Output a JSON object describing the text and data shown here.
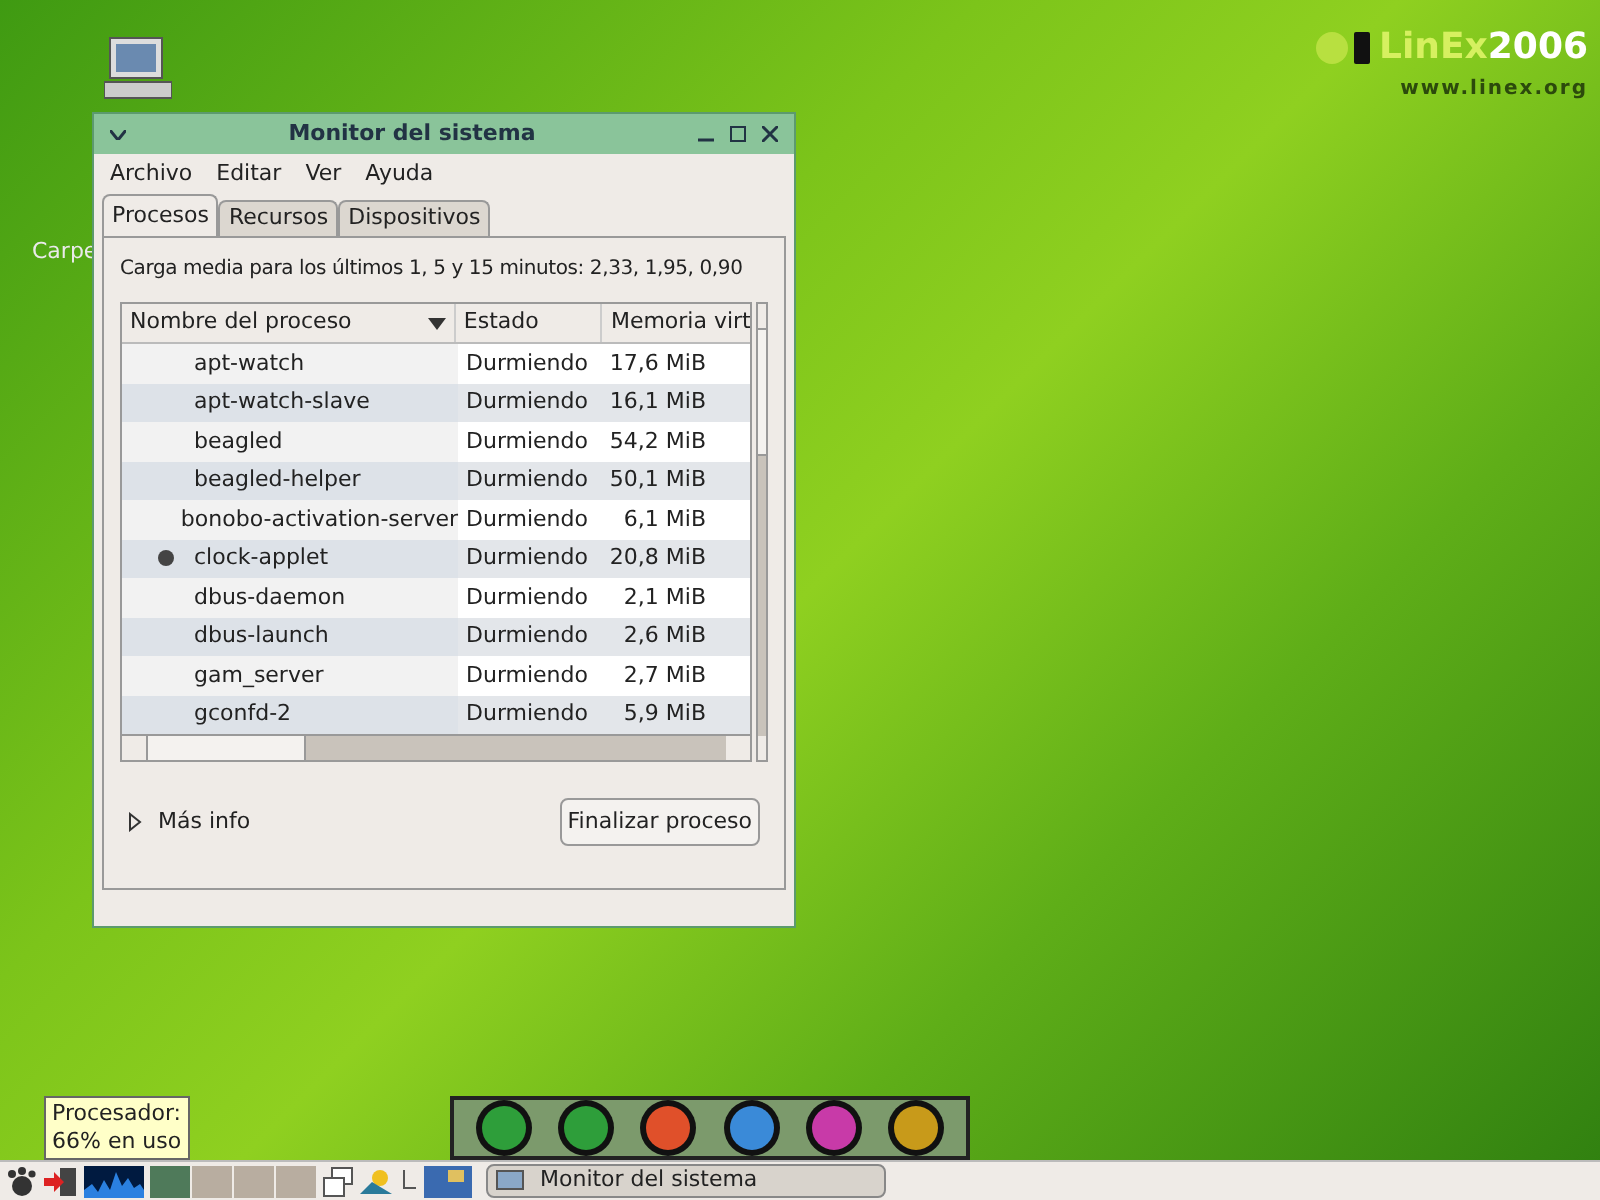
{
  "desktop": {
    "icon_label": "Carpe",
    "logo": {
      "brand": "LinEx",
      "year": "2006",
      "url": "www.linex.org"
    }
  },
  "window": {
    "title": "Monitor del sistema",
    "menu": [
      "Archivo",
      "Editar",
      "Ver",
      "Ayuda"
    ],
    "tabs": [
      {
        "label": "Procesos",
        "selected": true
      },
      {
        "label": "Recursos",
        "selected": false
      },
      {
        "label": "Dispositivos",
        "selected": false
      }
    ],
    "load_text": "Carga media para los últimos 1, 5 y 15 minutos: 2,33, 1,95, 0,90",
    "table": {
      "columns": [
        {
          "label": "Nombre del proceso",
          "sorted": true
        },
        {
          "label": "Estado",
          "sorted": false
        },
        {
          "label": "Memoria virt",
          "sorted": false
        }
      ],
      "rows": [
        {
          "kind": "plain",
          "name": "apt-watch",
          "state": "Durmiendo",
          "memory": "17,6 MiB"
        },
        {
          "kind": "plain",
          "name": "apt-watch-slave",
          "state": "Durmiendo",
          "memory": "16,1 MiB"
        },
        {
          "kind": "plain",
          "name": "beagled",
          "state": "Durmiendo",
          "memory": "54,2 MiB"
        },
        {
          "kind": "plain",
          "name": "beagled-helper",
          "state": "Durmiendo",
          "memory": "50,1 MiB"
        },
        {
          "kind": "plain",
          "name": "bonobo-activation-server",
          "state": "Durmiendo",
          "memory": "6,1 MiB"
        },
        {
          "kind": "applet",
          "name": "clock-applet",
          "state": "Durmiendo",
          "memory": "20,8 MiB"
        },
        {
          "kind": "plain",
          "name": "dbus-daemon",
          "state": "Durmiendo",
          "memory": "2,1 MiB"
        },
        {
          "kind": "plain",
          "name": "dbus-launch",
          "state": "Durmiendo",
          "memory": "2,6 MiB"
        },
        {
          "kind": "plain",
          "name": "gam_server",
          "state": "Durmiendo",
          "memory": "2,7 MiB"
        },
        {
          "kind": "plain",
          "name": "gconfd-2",
          "state": "Durmiendo",
          "memory": "5,9 MiB"
        }
      ]
    },
    "more_info": {
      "label": "Más info",
      "expanded": false
    },
    "end_button": "Finalizar proceso"
  },
  "tooltip": {
    "lines": [
      "Procesador:",
      "66% en uso"
    ]
  },
  "dock": {
    "items": [
      {
        "color": "#2e9e3a"
      },
      {
        "color": "#2e9e3a"
      },
      {
        "color": "#e0502a"
      },
      {
        "color": "#3a8ad8"
      },
      {
        "color": "#c83aa8"
      },
      {
        "color": "#c89a1a"
      }
    ]
  },
  "taskbar": {
    "workspaces": [
      {
        "selected": true
      },
      {
        "selected": false
      },
      {
        "selected": false
      },
      {
        "selected": false
      }
    ],
    "tasks": [
      {
        "label": "Monitor del sistema",
        "selected": true
      }
    ]
  }
}
